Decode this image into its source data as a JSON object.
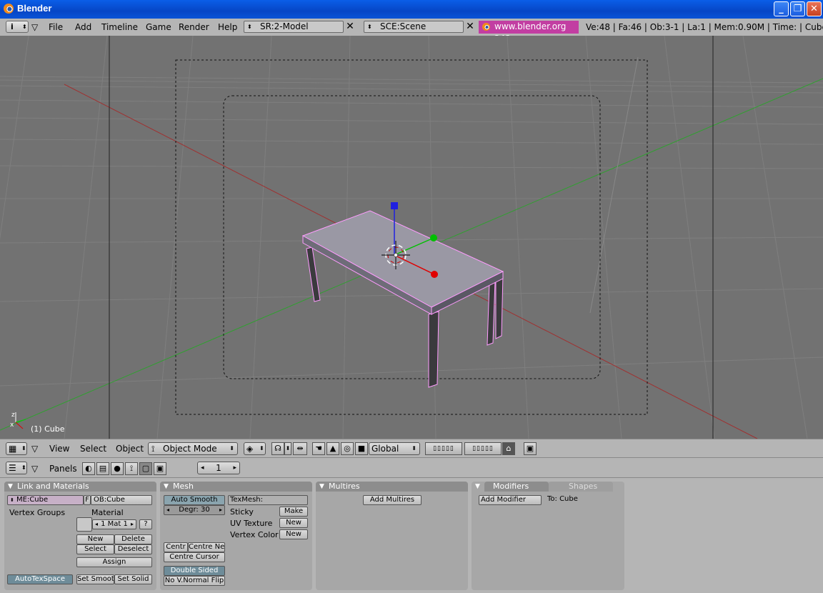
{
  "window": {
    "title": "Blender"
  },
  "info_header": {
    "menus": [
      "File",
      "Add",
      "Timeline",
      "Game",
      "Render",
      "Help"
    ],
    "screen_field": "SR:2-Model",
    "scene_field": "SCE:Scene",
    "url": "www.blender.org 243",
    "stats": "Ve:48 | Fa:46 | Ob:3-1 | La:1  | Mem:0.90M  | Time: | Cube"
  },
  "viewport": {
    "object_label": "(1) Cube"
  },
  "view3d_header": {
    "menus": [
      "View",
      "Select",
      "Object"
    ],
    "mode": "Object Mode",
    "orientation": "Global"
  },
  "buttons_header": {
    "panels_label": "Panels",
    "frame_number": "1"
  },
  "panel_link_materials": {
    "title": "Link and Materials",
    "mesh_name": "ME:Cube",
    "fake_user": "F",
    "object_name": "OB:Cube",
    "vertex_groups_label": "Vertex Groups",
    "material_label": "Material",
    "material_slot": "1 Mat 1",
    "help": "?",
    "new": "New",
    "delete": "Delete",
    "select": "Select",
    "deselect": "Deselect",
    "assign": "Assign",
    "auto_tex_space": "AutoTexSpace",
    "set_smooth": "Set Smoot",
    "set_solid": "Set Solid"
  },
  "panel_mesh": {
    "title": "Mesh",
    "auto_smooth": "Auto Smooth",
    "degree": "Degr: 30",
    "tex_mesh": "TexMesh:",
    "sticky_label": "Sticky",
    "make": "Make",
    "uv_texture_label": "UV Texture",
    "uv_new": "New",
    "vertex_color_label": "Vertex Color",
    "vc_new": "New",
    "centre": "Centr",
    "centre_new": "Centre Ne",
    "centre_cursor": "Centre Cursor",
    "double_sided": "Double Sided",
    "no_v_normal_flip": "No V.Normal Flip"
  },
  "panel_multires": {
    "title": "Multires",
    "add_multires": "Add Multires"
  },
  "panel_modifiers": {
    "tab_modifiers": "Modifiers",
    "tab_shapes": "Shapes",
    "add_modifier": "Add Modifier",
    "to_label": "To: Cube"
  },
  "colors": {
    "viewport_bg": "#727272",
    "panel_bg": "#a7a7a7",
    "header_bg": "#b5b5b5",
    "url_bg": "#c23ea2",
    "selection_outline": "#ff9cff",
    "axis_x": "#e00000",
    "axis_y": "#00c000",
    "axis_z": "#2020e0"
  }
}
